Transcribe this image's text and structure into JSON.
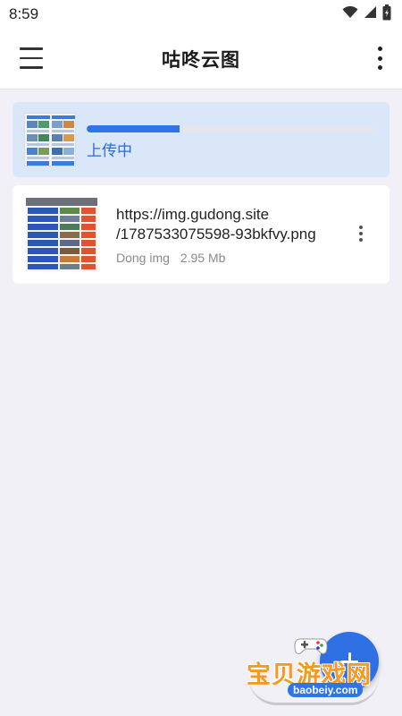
{
  "status_bar": {
    "time": "8:59",
    "icons": [
      "wifi-icon",
      "signal-icon",
      "battery-icon"
    ]
  },
  "app_bar": {
    "title": "咕咚云图",
    "menu_icon": "hamburger-menu-icon",
    "more_icon": "more-vertical-icon"
  },
  "upload": {
    "label": "上传中",
    "progress": 0.32
  },
  "files": [
    {
      "url": "https://img.gudong.site /1787533075598-93bkfvy.png",
      "source": "Dong img",
      "size": "2.95 Mb"
    }
  ],
  "fab": {
    "icon": "plus-icon"
  },
  "watermark": {
    "text": "宝贝游戏网",
    "url": "baobeiy.com"
  },
  "colors": {
    "accent": "#2f74e9",
    "upload_card_bg": "#dae7f9",
    "page_bg": "#f0f0f6"
  }
}
